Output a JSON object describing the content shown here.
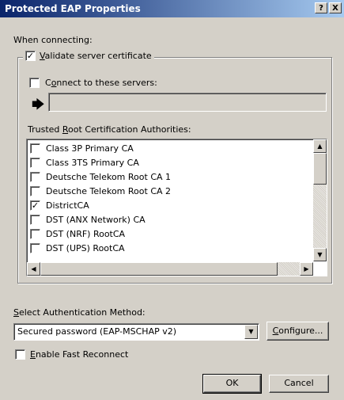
{
  "window": {
    "title": "Protected EAP Properties",
    "help_btn": "?",
    "close_btn": "X"
  },
  "when_connecting": "When connecting:",
  "validate_cert": {
    "prefix": "",
    "accel": "V",
    "rest": "alidate server certificate",
    "checked": true
  },
  "connect_servers": {
    "accel_prefix": "C",
    "accel": "o",
    "rest": "nnect to these servers:",
    "checked": false,
    "value": ""
  },
  "trusted_root": {
    "prefix": "Trusted ",
    "accel": "R",
    "rest": "oot Certification Authorities:"
  },
  "ca_list": [
    {
      "name": "Class 3P Primary CA",
      "checked": false
    },
    {
      "name": "Class 3TS Primary CA",
      "checked": false
    },
    {
      "name": "Deutsche Telekom Root CA 1",
      "checked": false
    },
    {
      "name": "Deutsche Telekom Root CA 2",
      "checked": false
    },
    {
      "name": "DistrictCA",
      "checked": true
    },
    {
      "name": "DST (ANX Network) CA",
      "checked": false
    },
    {
      "name": "DST (NRF) RootCA",
      "checked": false
    },
    {
      "name": "DST (UPS) RootCA",
      "checked": false
    }
  ],
  "auth_method": {
    "label_accel": "S",
    "label_rest": "elect Authentication Method:",
    "selected": "Secured password (EAP-MSCHAP v2)",
    "configure_accel": "C",
    "configure_rest": "onfigure..."
  },
  "fast_reconnect": {
    "accel": "E",
    "rest": "nable Fast Reconnect",
    "checked": false
  },
  "buttons": {
    "ok": "OK",
    "cancel": "Cancel"
  }
}
